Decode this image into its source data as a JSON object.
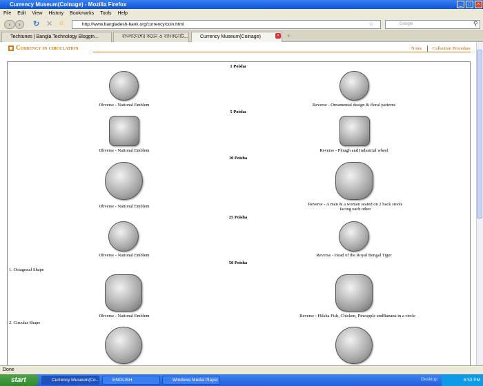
{
  "window": {
    "title": "Currency Museum(Coinage) - Mozilla Firefox"
  },
  "menu": [
    "File",
    "Edit",
    "View",
    "History",
    "Bookmarks",
    "Tools",
    "Help"
  ],
  "nav": {
    "url": "http://www.bangladesh-bank.org/currency/coin.html",
    "search_placeholder": "Google"
  },
  "tabs": [
    {
      "label": "Techtunes | Bangla Technology Bloggin..."
    },
    {
      "label": "বাংলাদেশের কয়েন ও ব্যাংকনোট..."
    },
    {
      "label": "Currency Museum(Coinage)"
    }
  ],
  "page": {
    "heading": "Currency in circulation",
    "links": [
      "Notes",
      "Collection Procedure"
    ],
    "sections": [
      {
        "denom": "1 Poisha",
        "obverse": "Obverse - National Emblem",
        "reverse": "Reverse - Ornamental design & floral patterns"
      },
      {
        "denom": "5 Poisha",
        "obverse": "Obverse - National Emblem",
        "reverse": "Reverse - Plough and Industrial wheel"
      },
      {
        "denom": "10 Poisha",
        "obverse": "Obverse - National Emblem",
        "reverse": "Reverse - A man & a woman seated on 2 back stools facing each other"
      },
      {
        "denom": "25 Poisha",
        "obverse": "Obverse - National Emblem",
        "reverse": "Reverse - Head of the Royal Bengal Tiger"
      },
      {
        "denom": "50 Poisha",
        "sub1": "1. Octagonal Shape",
        "obverse": "Obverse - National Emblem",
        "reverse": "Reverse - Hilsha Fish, Chicken, Pineapple andBanana in a circle",
        "sub2": "2. Circular Shape"
      }
    ]
  },
  "status": "Done",
  "taskbar": {
    "start": "start",
    "items": [
      "Currency Museum(Co...",
      "ENGLISH",
      "Windows Media Player"
    ],
    "desktop": "Desktop",
    "time": "6:53 PM"
  }
}
